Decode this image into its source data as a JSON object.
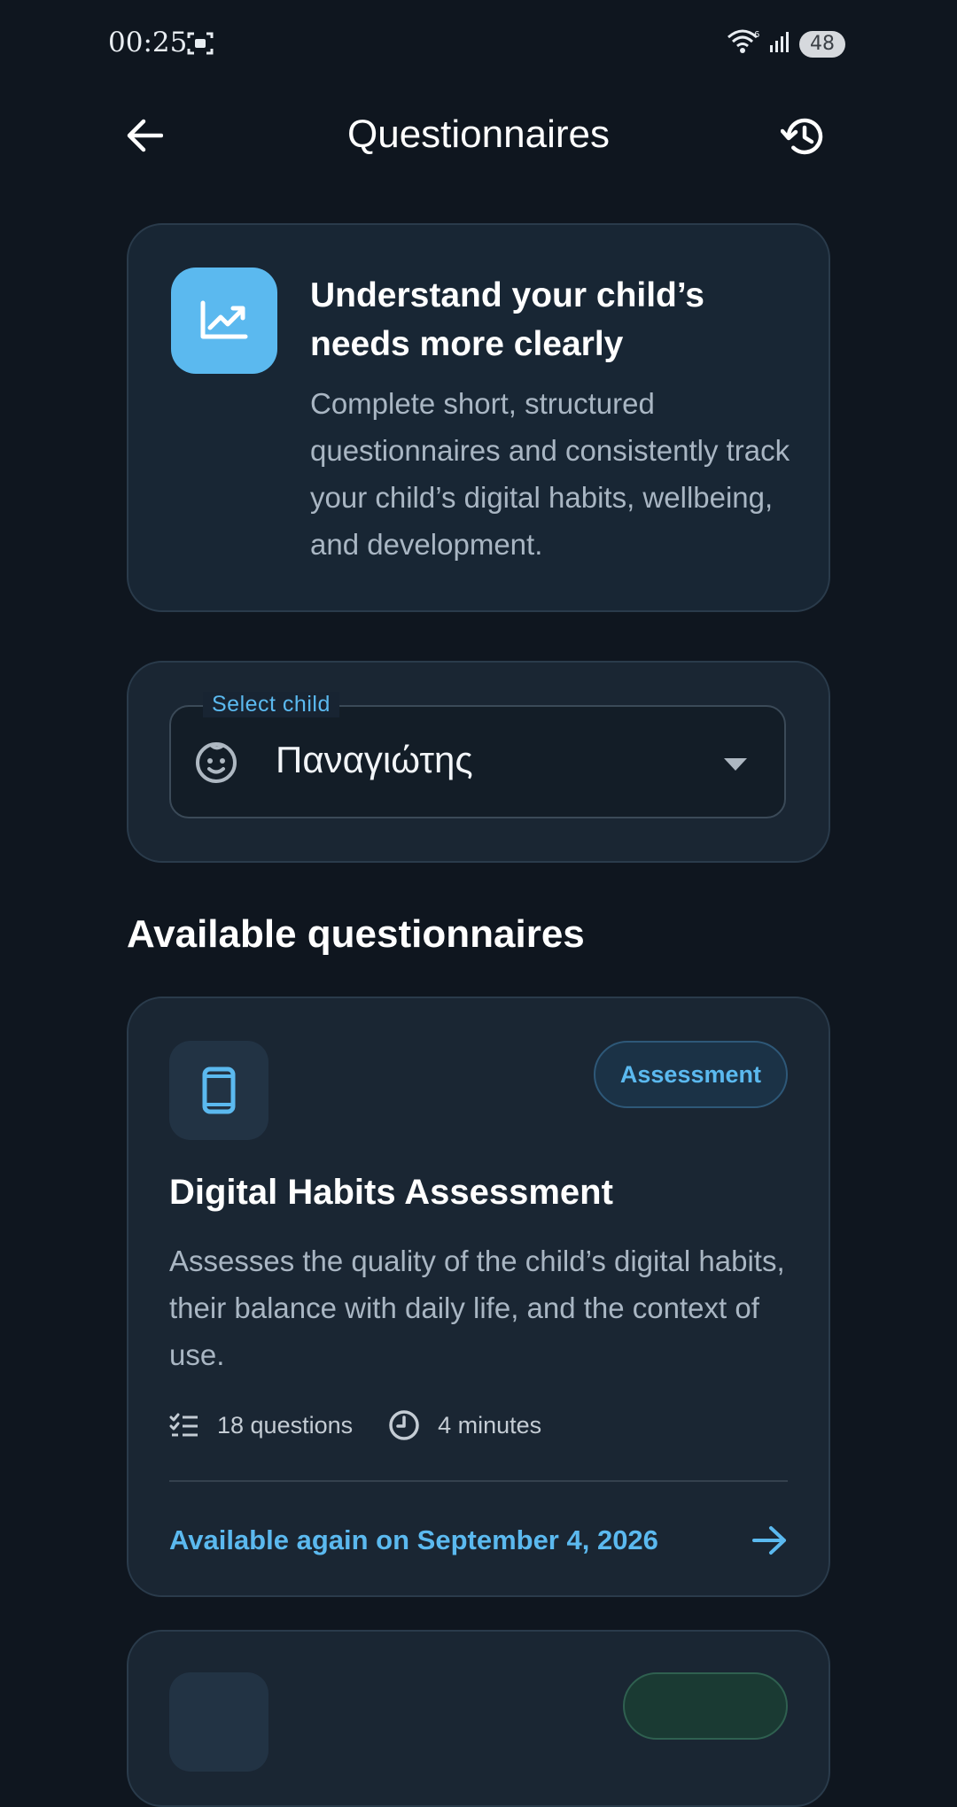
{
  "status_bar": {
    "time": "00:25",
    "battery": "48"
  },
  "appbar": {
    "title": "Questionnaires"
  },
  "intro": {
    "title": "Understand your child’s needs more clearly",
    "description": "Complete short, structured questionnaires and consistently track your child’s digital habits, wellbeing, and development."
  },
  "child_select": {
    "label": "Select child",
    "value": "Παναγιώτης"
  },
  "section": {
    "title": "Available questionnaires"
  },
  "questionnaires": [
    {
      "badge": "Assessment",
      "title": "Digital Habits Assessment",
      "description": "Assesses the quality of the child’s digital habits, their balance with daily life, and the context of use.",
      "questions": "18 questions",
      "duration": "4 minutes",
      "action": "Available again on September 4, 2026"
    }
  ],
  "colors": {
    "accent": "#5bb9ef",
    "background": "#0f161f",
    "card": "#1a2633"
  }
}
